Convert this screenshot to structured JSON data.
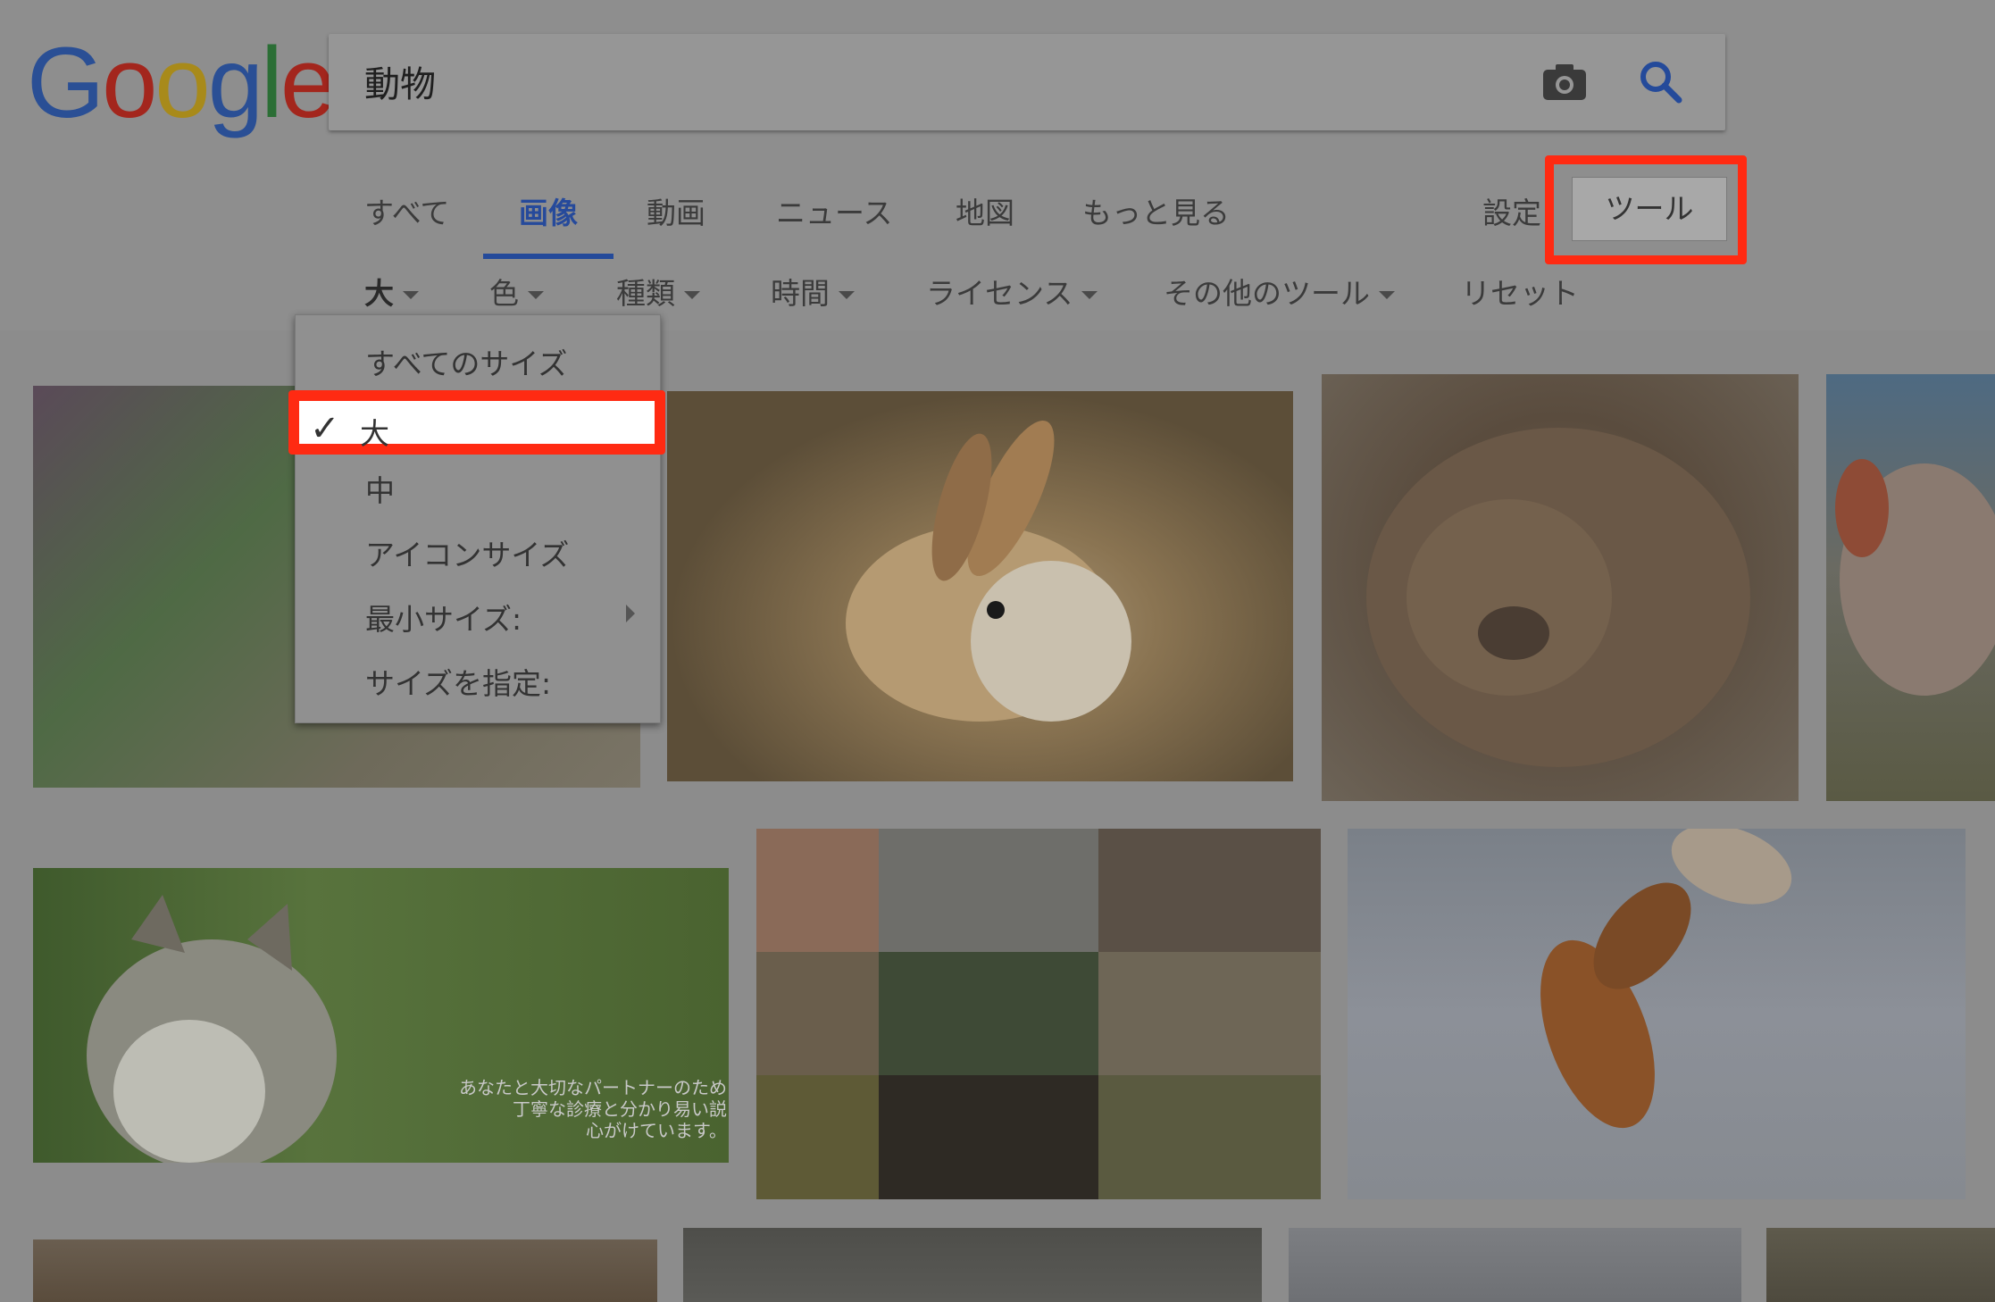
{
  "logo": {
    "letters": [
      "G",
      "o",
      "o",
      "g",
      "l",
      "e"
    ],
    "colors": [
      "#2a4f95",
      "#a3261d",
      "#a88a1a",
      "#2a4f95",
      "#2b6e35",
      "#a3261d"
    ]
  },
  "search": {
    "query": "動物",
    "camera_icon": "camera-icon",
    "search_icon": "search-icon"
  },
  "tabs": [
    {
      "label": "すべて",
      "active": false
    },
    {
      "label": "画像",
      "active": true
    },
    {
      "label": "動画",
      "active": false
    },
    {
      "label": "ニュース",
      "active": false
    },
    {
      "label": "地図",
      "active": false
    },
    {
      "label": "もっと見る",
      "active": false
    }
  ],
  "settings_label": "設定",
  "tools_label": "ツール",
  "filters": [
    {
      "label": "大",
      "dropdown": true
    },
    {
      "label": "色",
      "dropdown": true
    },
    {
      "label": "種類",
      "dropdown": true
    },
    {
      "label": "時間",
      "dropdown": true
    },
    {
      "label": "ライセンス",
      "dropdown": true
    },
    {
      "label": "その他のツール",
      "dropdown": true
    },
    {
      "label": "リセット",
      "dropdown": false
    }
  ],
  "size_menu": {
    "items": [
      {
        "label": "すべてのサイズ",
        "selected": false
      },
      {
        "label": "大",
        "selected": true
      },
      {
        "label": "中",
        "selected": false
      },
      {
        "label": "アイコンサイズ",
        "selected": false
      },
      {
        "label": "最小サイズ:",
        "selected": false,
        "submenu": true
      },
      {
        "label": "サイズを指定:",
        "selected": false
      }
    ]
  },
  "results": {
    "images": [
      {
        "subject": "cat among flowers",
        "color": "#5e6a52"
      },
      {
        "subject": "rabbit",
        "color": "#7a6a4f"
      },
      {
        "subject": "wombat",
        "color": "#5f5244"
      },
      {
        "subject": "pig",
        "color": "#5c5e58"
      },
      {
        "subject": "cat in grass",
        "color": "#4d6237"
      },
      {
        "subject": "animal collage",
        "color": "#4a4a44"
      },
      {
        "subject": "fox in snow",
        "color": "#868c96"
      },
      {
        "subject": "fox",
        "color": "#5b5045"
      },
      {
        "subject": "animal",
        "color": "#555550"
      },
      {
        "subject": "animal",
        "color": "#7a7c80"
      },
      {
        "subject": "animal",
        "color": "#5e5a4c"
      }
    ],
    "overlay_text": [
      "あなたと大切なパートナーのため",
      "丁寧な診療と分かり易い説",
      "心がけています。"
    ]
  }
}
